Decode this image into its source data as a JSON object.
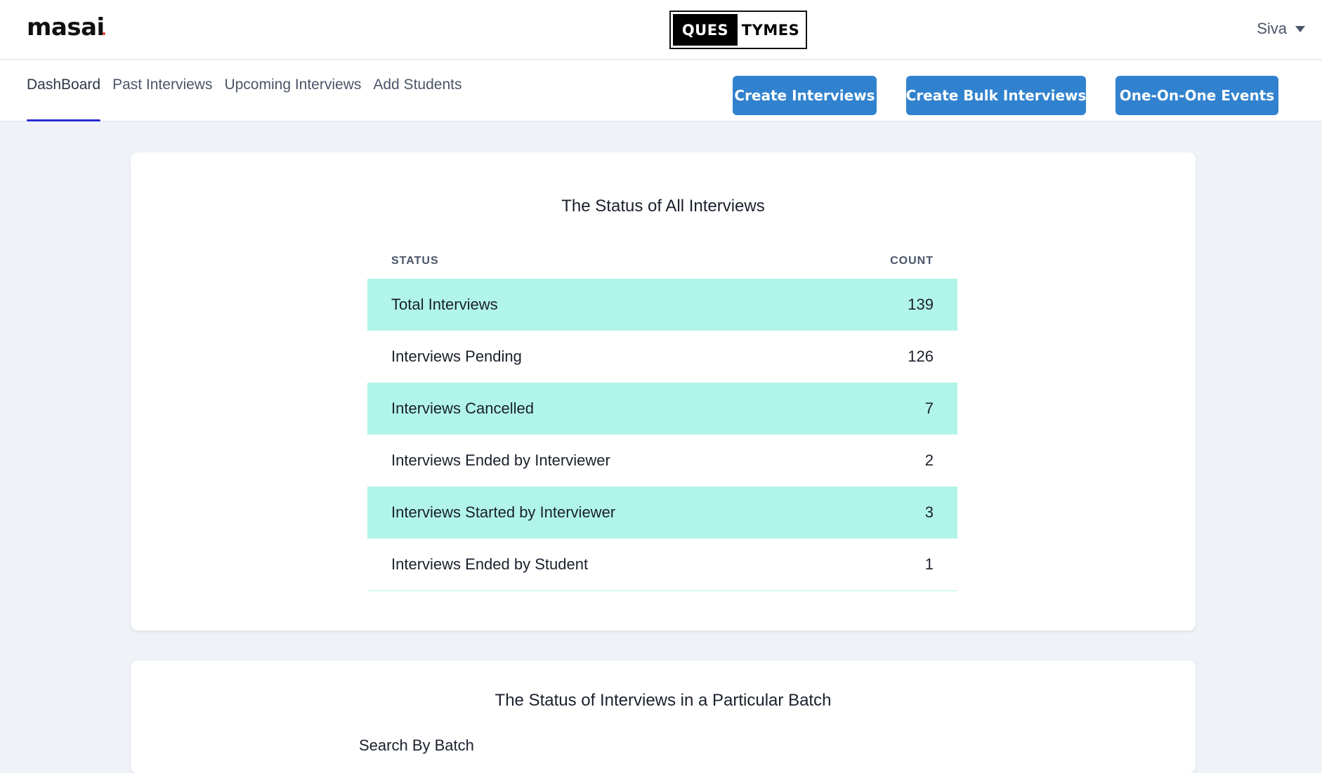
{
  "header": {
    "logo": "masai",
    "brand_left": "QUES",
    "brand_right": "TYMES",
    "user_name": "Siva"
  },
  "nav": {
    "tabs": [
      {
        "label": "DashBoard",
        "active": true
      },
      {
        "label": "Past Interviews",
        "active": false
      },
      {
        "label": "Upcoming Interviews",
        "active": false
      },
      {
        "label": "Add Students",
        "active": false
      }
    ],
    "buttons": {
      "create": "Create Interviews",
      "bulk": "Create Bulk Interviews",
      "one_on_one": "One-On-One Events"
    }
  },
  "overview": {
    "title": "The Status of All Interviews",
    "columns": {
      "status": "STATUS",
      "count": "COUNT"
    },
    "rows": [
      {
        "status": "Total Interviews",
        "count": "139"
      },
      {
        "status": "Interviews Pending",
        "count": "126"
      },
      {
        "status": "Interviews Cancelled",
        "count": "7"
      },
      {
        "status": "Interviews Ended by Interviewer",
        "count": "2"
      },
      {
        "status": "Interviews Started by Interviewer",
        "count": "3"
      },
      {
        "status": "Interviews Ended by Student",
        "count": "1"
      }
    ]
  },
  "batch": {
    "title": "The Status of Interviews in a Particular Batch",
    "search_label": "Search By Batch"
  },
  "colors": {
    "accent": "#3182ce",
    "row_highlight": "#b1f5e8",
    "active_tab_underline": "#2b2bd6",
    "page_background": "#eff3f8"
  }
}
